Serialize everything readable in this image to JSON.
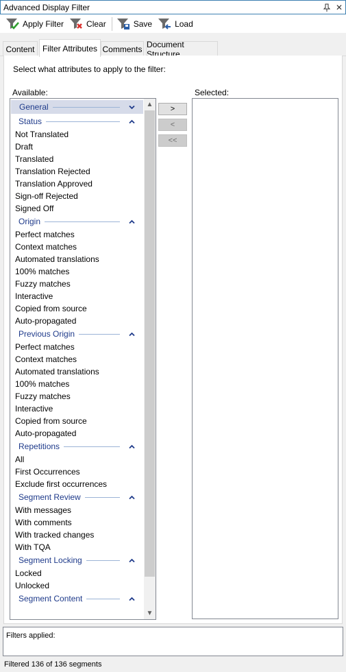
{
  "window": {
    "title": "Advanced Display Filter"
  },
  "toolbar": {
    "apply_label": "Apply Filter",
    "clear_label": "Clear",
    "save_label": "Save",
    "load_label": "Load"
  },
  "tabs": [
    {
      "label": "Content"
    },
    {
      "label": "Filter Attributes"
    },
    {
      "label": "Comments"
    },
    {
      "label": "Document Structure"
    }
  ],
  "panel": {
    "instruction": "Select what attributes to apply to the filter:",
    "available_label": "Available:",
    "selected_label": "Selected:"
  },
  "buttons": {
    "add": ">",
    "remove": "<",
    "remove_all": "<<"
  },
  "groups": [
    {
      "title": "General",
      "collapsed": true,
      "items": []
    },
    {
      "title": "Status",
      "items": [
        "Not Translated",
        "Draft",
        "Translated",
        "Translation Rejected",
        "Translation Approved",
        "Sign-off Rejected",
        "Signed Off"
      ]
    },
    {
      "title": "Origin",
      "items": [
        "Perfect matches",
        "Context matches",
        "Automated translations",
        "100% matches",
        "Fuzzy matches",
        "Interactive",
        "Copied from source",
        "Auto-propagated"
      ]
    },
    {
      "title": "Previous Origin",
      "items": [
        "Perfect matches",
        "Context matches",
        "Automated translations",
        "100% matches",
        "Fuzzy matches",
        "Interactive",
        "Copied from source",
        "Auto-propagated"
      ]
    },
    {
      "title": "Repetitions",
      "items": [
        "All",
        "First Occurrences",
        "Exclude first occurrences"
      ]
    },
    {
      "title": "Segment Review",
      "items": [
        "With messages",
        "With comments",
        "With tracked changes",
        "With TQA"
      ]
    },
    {
      "title": "Segment Locking",
      "items": [
        "Locked",
        "Unlocked"
      ]
    },
    {
      "title": "Segment Content",
      "items": []
    }
  ],
  "filters_applied_label": "Filters applied:",
  "status_text": "Filtered 136 of 136 segments",
  "colors": {
    "group_title": "#1e3a8a",
    "general_bg": "#d6dbe9",
    "title_border": "#3c7fb1"
  },
  "icons": {
    "pin": "pin-icon",
    "close": "close-icon"
  }
}
